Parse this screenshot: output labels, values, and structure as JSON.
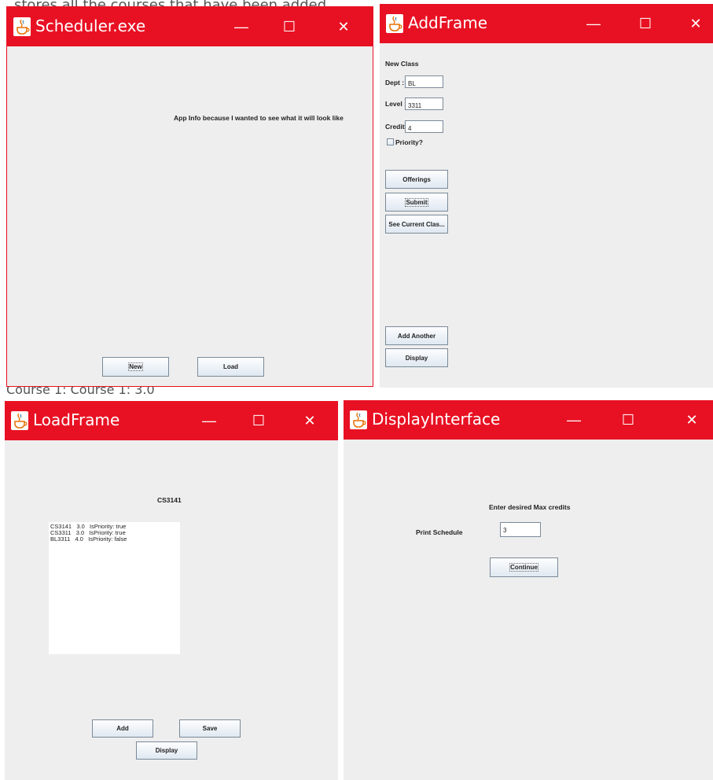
{
  "background": {
    "text_fragments": [
      "stores all the courses that have been added",
      "Course 1: Course 1: 3.0"
    ]
  },
  "colors": {
    "titlebar": "#e81123",
    "window_bg": "#eeeeee"
  },
  "window_controls": {
    "minimize": "—",
    "maximize": "☐",
    "close": "✕"
  },
  "scheduler": {
    "title": "Scheduler.exe",
    "app_info": "App Info because I wanted to see what it will look like",
    "new_button": "New",
    "load_button": "Load"
  },
  "add_frame": {
    "title": "AddFrame",
    "heading": "New Class",
    "dept_label": "Dept :",
    "dept_value": "BL",
    "level_label": "Level :",
    "level_value": "3311",
    "credits_label": "Credits:",
    "credits_value": "4",
    "priority_label": "Priority?",
    "buttons": {
      "offerings": "Offerings",
      "submit": "Submit",
      "see_current": "See Current Clas...",
      "add_another": "Add Another",
      "display": "Display"
    }
  },
  "load_frame": {
    "title": "LoadFrame",
    "selected_label": "CS3141",
    "list_items": [
      "CS3141   3.0   IsPriority: true",
      "CS3311   3.0   IsPriority: true",
      "BL3311   4.0   IsPriority: false"
    ],
    "buttons": {
      "add": "Add",
      "save": "Save",
      "display": "Display"
    }
  },
  "display_interface": {
    "title": "DisplayInterface",
    "prompt": "Enter desired Max credits",
    "print_schedule": "Print Schedule",
    "max_credits_value": "3",
    "continue_button": "Continue"
  }
}
